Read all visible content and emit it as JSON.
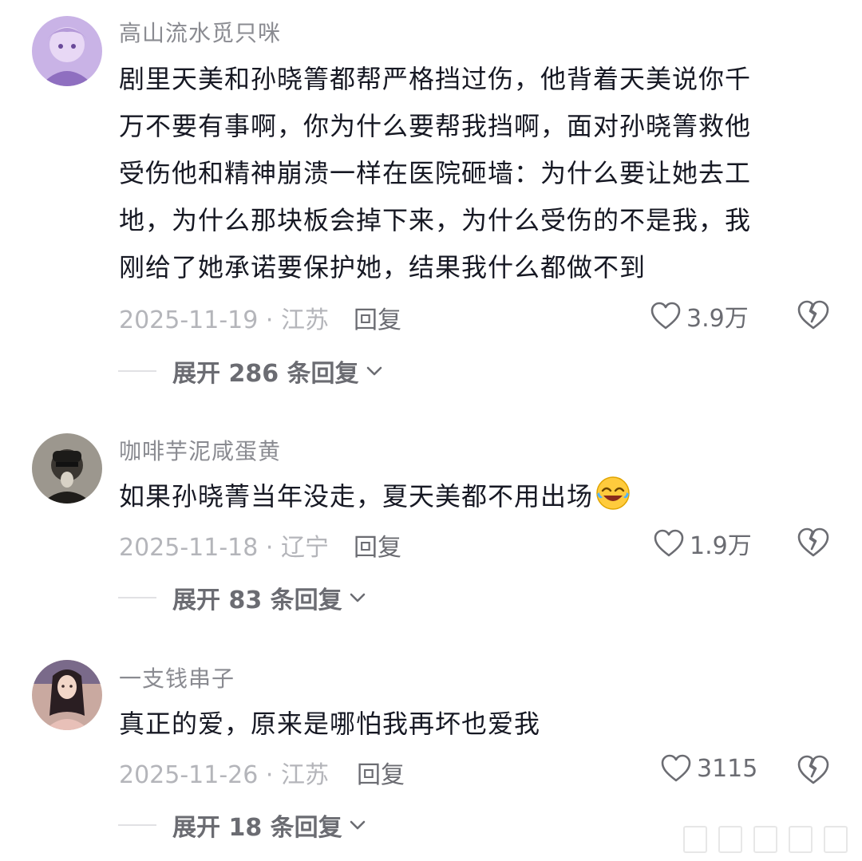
{
  "comments": [
    {
      "username": "高山流水觅只咪",
      "text_lines": [
        "剧里天美和孙晓箐都帮严格挡过伤，他背着天美说你千",
        "万不要有事啊，你为什么要帮我挡啊，面对孙晓箐救他",
        "受伤他和精神崩溃一样在医院砸墙：为什么要让她去工",
        "地，为什么那块板会掉下来，为什么受伤的不是我，我",
        "刚给了她承诺要保护她，结果我什么都做不到"
      ],
      "date_location": "2025-11-19 · 江苏",
      "reply_label": "回复",
      "likes": "3.9万",
      "expand_label": "展开 286 条回复"
    },
    {
      "username": "咖啡芋泥咸蛋黄",
      "text": "如果孙晓菁当年没走，夏天美都不用出场",
      "emoji": "laughing-crying-emoji",
      "date_location": "2025-11-18 · 辽宁",
      "reply_label": "回复",
      "likes": "1.9万",
      "expand_label": "展开 83 条回复"
    },
    {
      "username": "一支钱串子",
      "text": "真正的爱，原来是哪怕我再坏也爱我",
      "date_location": "2025-11-26 · 江苏",
      "reply_label": "回复",
      "likes": "3115",
      "expand_label": "展开 18 条回复"
    }
  ],
  "icons": {
    "like": "heart-outline-icon",
    "dislike": "broken-heart-icon",
    "expand": "chevron-down-icon"
  },
  "colors": {
    "text": "#161823",
    "username": "#8a8b91",
    "meta": "#b4b5ba",
    "action": "#6b6c72"
  }
}
